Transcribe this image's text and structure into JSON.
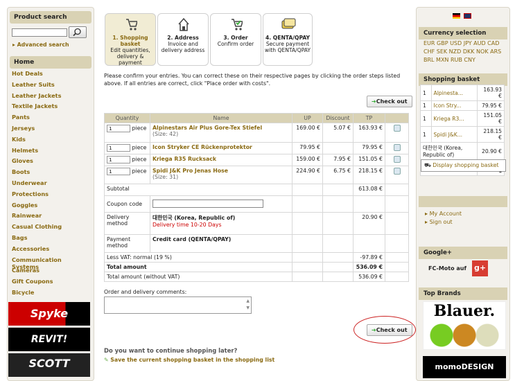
{
  "left": {
    "product_search": "Product search",
    "advanced_search": "Advanced search",
    "home": "Home",
    "categories": [
      "Hot Deals",
      "Leather Suits",
      "Leather Jackets",
      "Textile Jackets",
      "Pants",
      "Jerseys",
      "Kids",
      "Helmets",
      "Gloves",
      "Boots",
      "Underwear",
      "Protections",
      "Goggles",
      "Rainwear",
      "Casual Clothing",
      "Bags",
      "Accessories",
      "Communication Systems",
      "Cameras",
      "Gift Coupons",
      "Bicycle"
    ],
    "brands": [
      "Spyke",
      "REVIT!",
      "SCOTT"
    ]
  },
  "steps": [
    {
      "num": "1. Shopping basket",
      "desc": "Edit quantities, delivery & payment"
    },
    {
      "num": "2. Address",
      "desc": "Invoice and delivery address"
    },
    {
      "num": "3. Order",
      "desc": "Confirm order"
    },
    {
      "num": "4. QENTA/QPAY",
      "desc": "Secure payment with QENTA/QPAY"
    }
  ],
  "intro": "Please confirm your entries. You can correct these on their respective pages by clicking the order steps listed above. If all entries are correct, click \"Place order with costs\".",
  "checkout_label": "Check out",
  "table": {
    "headers": [
      "Quantity",
      "Name",
      "UP",
      "Discount",
      "TP"
    ],
    "piece": "piece",
    "rows": [
      {
        "qty": "1",
        "name": "Alpinestars Air Plus Gore-Tex Stiefel",
        "size": "(Size: 42)",
        "up": "169.00 €",
        "disc": "5.07 €",
        "tp": "163.93 €"
      },
      {
        "qty": "1",
        "name": "Icon Stryker CE Rückenprotektor",
        "size": "",
        "up": "79.95 €",
        "disc": "",
        "tp": "79.95 €"
      },
      {
        "qty": "1",
        "name": "Kriega R35 Rucksack",
        "size": "",
        "up": "159.00 €",
        "disc": "7.95 €",
        "tp": "151.05 €"
      },
      {
        "qty": "1",
        "name": "Spidi J&K Pro Jenas Hose",
        "size": "(Size: 31)",
        "up": "224.90 €",
        "disc": "6.75 €",
        "tp": "218.15 €"
      }
    ],
    "subtotal_label": "Subtotal",
    "subtotal": "613.08 €",
    "coupon_label": "Coupon code",
    "delivery_label": "Delivery method",
    "delivery_country": "대한민국 (Korea, Republic of)",
    "delivery_time": "Delivery time 10-20 Days",
    "delivery_cost": "20.90 €",
    "payment_label": "Payment method",
    "payment_value": "Credit card (QENTA/QPAY)",
    "vat_label": "Less VAT: normal (19 %)",
    "vat": "-97.89 €",
    "total_label": "Total amount",
    "total": "536.09 €",
    "total_novat_label": "Total amount (without VAT)",
    "total_novat": "536.09 €"
  },
  "comments_label": "Order and delivery comments:",
  "later_question": "Do you want to continue shopping later?",
  "later_link": "Save the current shopping basket in the shopping list",
  "right": {
    "currency_title": "Currency selection",
    "currencies": "EUR GBP USD JPY AUD CAD CHF SEK NZD DKK NOK ARS BRL MXN RUB CNY",
    "basket_title": "Shopping basket",
    "basket": [
      {
        "q": "1",
        "n": "Alpinesta...",
        "p": "163.93 €"
      },
      {
        "q": "1",
        "n": "Icon Stry...",
        "p": "79.95 €"
      },
      {
        "q": "1",
        "n": "Kriega R3...",
        "p": "151.05 €"
      },
      {
        "q": "1",
        "n": "Spidi J&K...",
        "p": "218.15 €"
      }
    ],
    "basket_country": "대한민국 (Korea, Republic of)",
    "basket_ship": "20.90 €",
    "basket_total_label": "Total amount",
    "basket_total": "536.09 €",
    "display_basket": "Display shopping basket",
    "my_account": "My Account",
    "sign_out": "Sign out",
    "google_title": "Google+",
    "google_text": "FC-Moto auf",
    "google_badge": "g+",
    "brands_title": "Top Brands",
    "brand1": "Blauer.",
    "brand2": "momoDESIGN"
  },
  "colors": {
    "accent": "#8a6a12",
    "header_bg": "#d9d2b4",
    "panel_bg": "#f3f1ec",
    "red": "#cc0000"
  }
}
